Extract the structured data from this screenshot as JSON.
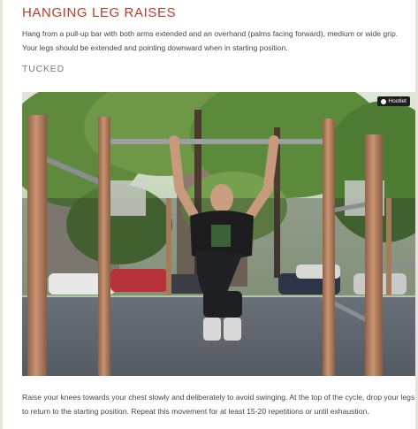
{
  "article": {
    "title": "HANGING LEG RAISES",
    "intro": "Hang from a pull-up bar with both arms extended and an overhand (palms facing forward), medium or wide grip. Your legs should be extended and pointing downward when in starting position.",
    "subhead": "TUCKED",
    "photo_badge": "Hootlet",
    "outro": "Raise your knees towards your chest slowly and deliberately to avoid swinging. At the top of the cycle, drop your legs to return to the starting position. Repeat this movement for at least 15-20 repetitions or until exhaustion."
  },
  "colors": {
    "accent": "#c0392b",
    "pole": "#b5825f",
    "ground": "#5f6670"
  }
}
